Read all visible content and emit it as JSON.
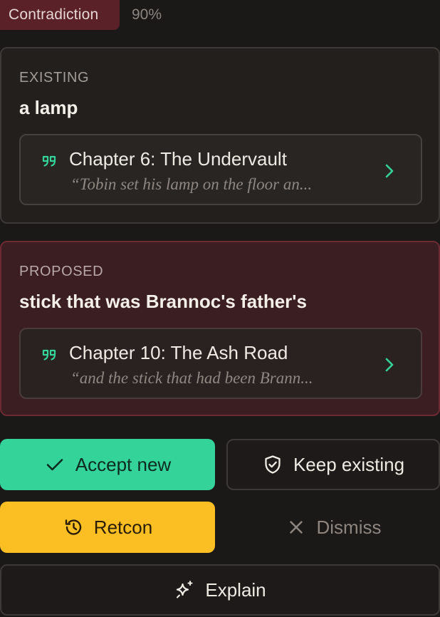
{
  "header": {
    "badge": "Contradiction",
    "confidence": "90%"
  },
  "existing": {
    "label": "EXISTING",
    "value": "a lamp",
    "citation": {
      "title": "Chapter 6: The Undervault",
      "excerpt": "“Tobin set his lamp on the floor an..."
    }
  },
  "proposed": {
    "label": "PROPOSED",
    "value": "stick that was Brannoc's father's",
    "citation": {
      "title": "Chapter 10: The Ash Road",
      "excerpt": "“and the stick that had been Brann..."
    }
  },
  "actions": {
    "accept": "Accept new",
    "keep": "Keep existing",
    "retcon": "Retcon",
    "dismiss": "Dismiss",
    "explain": "Explain"
  },
  "colors": {
    "contradiction": "#5a2128",
    "accept": "#34d399",
    "retcon": "#fbbf24",
    "quote_icon": "#34d399"
  },
  "icons": {
    "quote": "quote-icon",
    "chevron": "chevron-right-icon",
    "accept": "check-icon",
    "keep": "shield-check-icon",
    "retcon": "history-icon",
    "dismiss": "close-icon",
    "explain": "sparkles-icon"
  }
}
